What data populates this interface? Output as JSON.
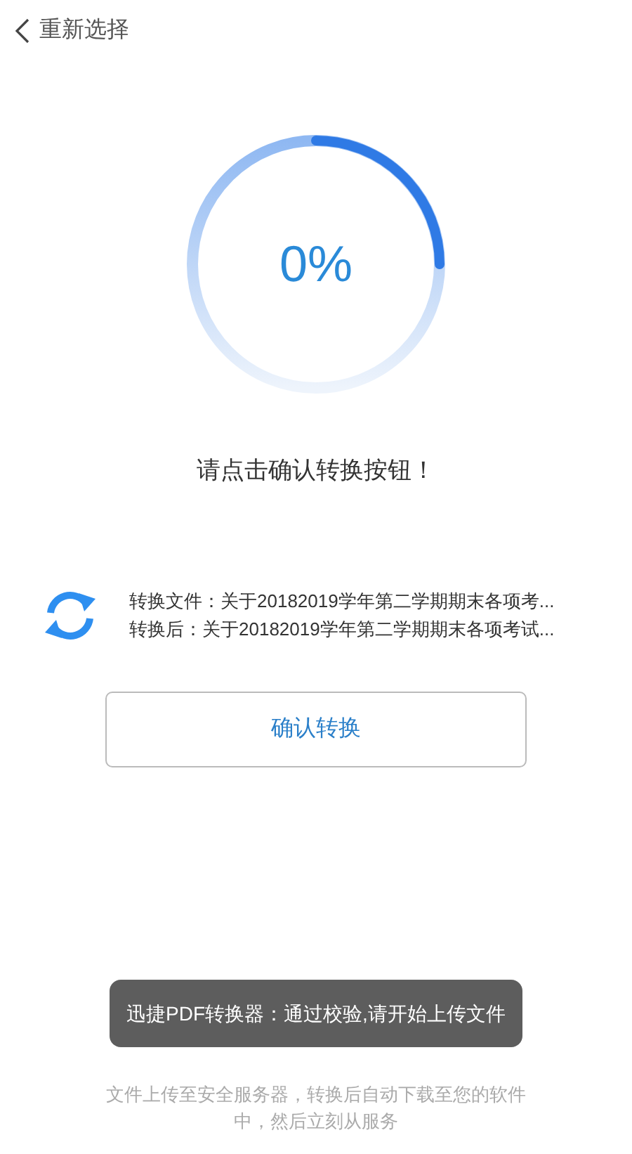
{
  "header": {
    "back_label": "重新选择"
  },
  "progress": {
    "percent": "0%"
  },
  "prompt": "请点击确认转换按钮！",
  "files": {
    "source": "转换文件：关于20182019学年第二学期期末各项考...",
    "target": "转换后：关于20182019学年第二学期期末各项考试..."
  },
  "confirm_button": "确认转换",
  "notice": {
    "lines": [
      "文件上传至安全服务器，转换后自动下载至您的软件",
      "中，然后立刻从服务"
    ]
  },
  "toast": "迅捷PDF转换器：通过校验,请开始上传文件"
}
